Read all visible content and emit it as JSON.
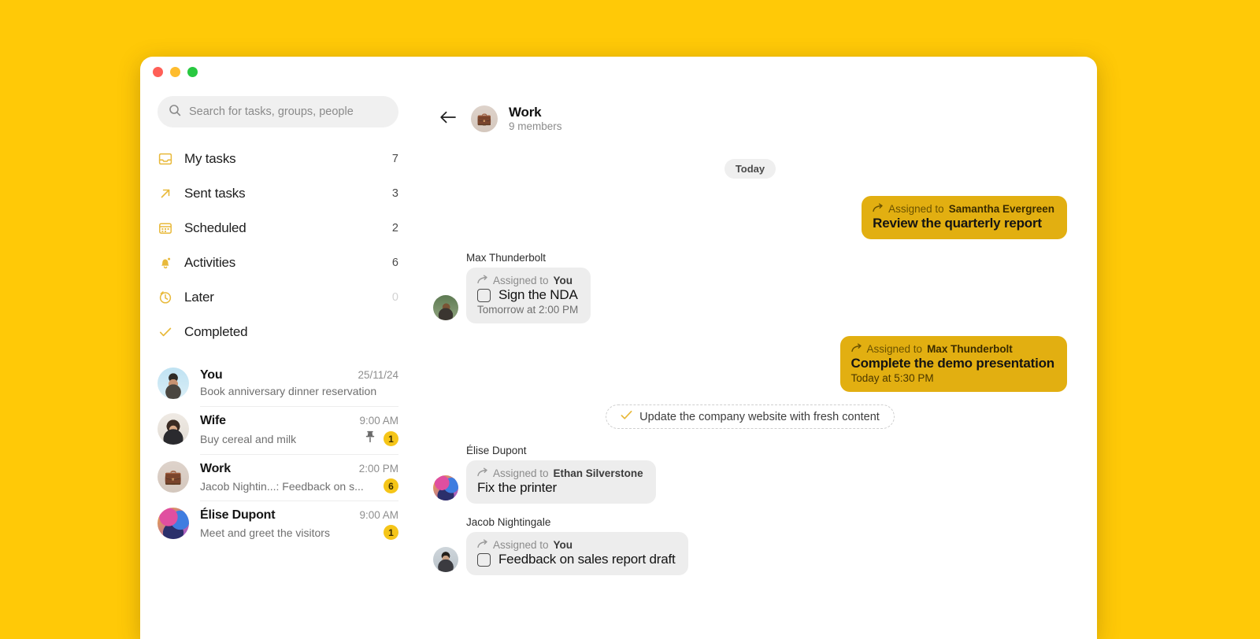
{
  "window": {
    "traffic_lights": [
      "close",
      "minimize",
      "maximize"
    ]
  },
  "colors": {
    "page_background": "#FFC907",
    "outgoing_bubble": "#E2AF11",
    "incoming_bubble": "#EDEDED",
    "accent_icon": "#E8B93A",
    "badge": "#F5C518"
  },
  "search": {
    "placeholder": "Search for tasks, groups, people",
    "value": "",
    "icon": "search-icon"
  },
  "sidebar": {
    "nav": [
      {
        "icon": "inbox-icon",
        "label": "My tasks",
        "count": "7"
      },
      {
        "icon": "arrow-up-right-icon",
        "label": "Sent tasks",
        "count": "3"
      },
      {
        "icon": "calendar-icon",
        "label": "Scheduled",
        "count": "2"
      },
      {
        "icon": "bell-icon",
        "label": "Activities",
        "count": "6"
      },
      {
        "icon": "clock-icon",
        "label": "Later",
        "count": "0"
      },
      {
        "icon": "check-icon",
        "label": "Completed",
        "count": ""
      }
    ],
    "conversations": [
      {
        "avatar": "you",
        "name": "You",
        "time": "25/11/24",
        "preview": "Book anniversary dinner reservation",
        "pinned": false,
        "badge": ""
      },
      {
        "avatar": "wife",
        "name": "Wife",
        "time": "9:00 AM",
        "preview": "Buy cereal and milk",
        "pinned": true,
        "badge": "1"
      },
      {
        "avatar": "work",
        "name": "Work",
        "time": "2:00 PM",
        "preview": "Jacob Nightin...: Feedback on s...",
        "pinned": false,
        "badge": "6"
      },
      {
        "avatar": "elise",
        "name": "Élise Dupont",
        "time": "9:00 AM",
        "preview": "Meet and greet the visitors",
        "pinned": false,
        "badge": "1"
      }
    ]
  },
  "chat": {
    "back_icon": "arrow-left-icon",
    "avatar": "work",
    "title": "Work",
    "subtitle": "9 members",
    "day_separator": "Today",
    "messages": [
      {
        "direction": "outgoing",
        "assigned_prefix": "Assigned to",
        "assignee": "Samantha Evergreen",
        "title": "Review the quarterly report",
        "time": "",
        "checkbox": false
      },
      {
        "direction": "incoming",
        "sender": "Max Thunderbolt",
        "avatar": "max",
        "assigned_prefix": "Assigned to",
        "assignee": "You",
        "title": "Sign the NDA",
        "time": "Tomorrow at 2:00 PM",
        "checkbox": true
      },
      {
        "direction": "outgoing",
        "assigned_prefix": "Assigned to",
        "assignee": "Max Thunderbolt",
        "title": "Complete the demo presentation",
        "time": "Today at 5:30 PM",
        "checkbox": false
      },
      {
        "direction": "completed",
        "title": "Update the company website with fresh content",
        "icon": "check-icon"
      },
      {
        "direction": "incoming",
        "sender": "Élise Dupont",
        "avatar": "elise",
        "assigned_prefix": "Assigned to",
        "assignee": "Ethan Silverstone",
        "title": "Fix the printer",
        "time": "",
        "checkbox": false
      },
      {
        "direction": "incoming",
        "sender": "Jacob Nightingale",
        "avatar": "jacob",
        "assigned_prefix": "Assigned to",
        "assignee": "You",
        "title": "Feedback on sales report draft",
        "time": "",
        "checkbox": true
      }
    ]
  }
}
